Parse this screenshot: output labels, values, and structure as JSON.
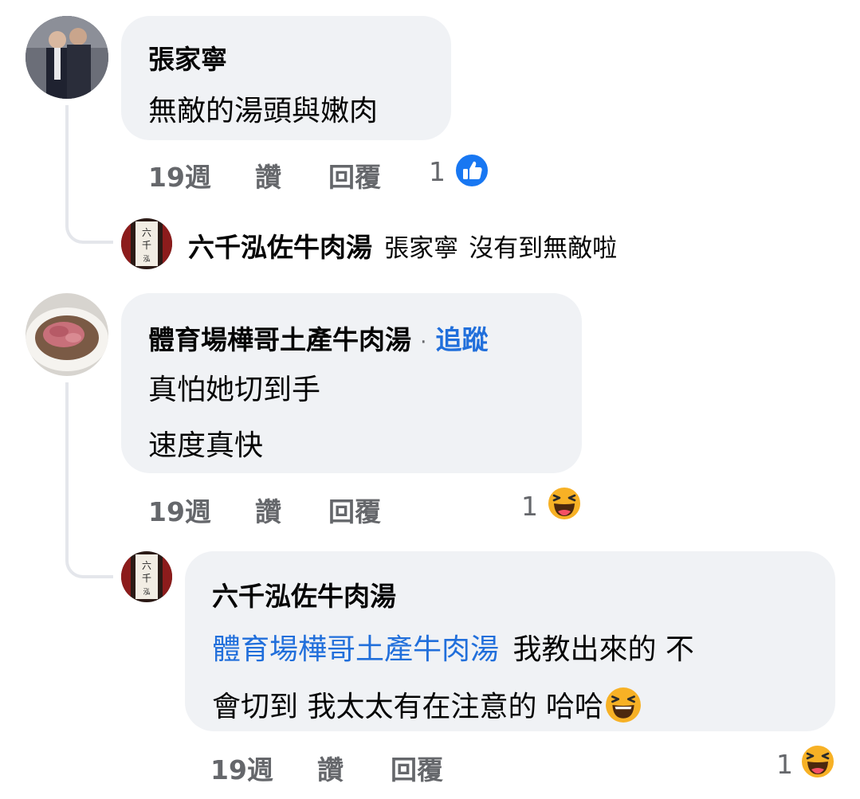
{
  "comments": [
    {
      "author": "張家寧",
      "lines": [
        "無敵的湯頭與嫩肉"
      ],
      "time": "19週",
      "like": "讚",
      "reply": "回覆",
      "reaction_count": "1",
      "reaction_icon": "like-reaction-icon"
    },
    {
      "author": "體育場樺哥土產牛肉湯",
      "follow": "追蹤",
      "follow_separator": "·",
      "lines": [
        "真怕她切到手",
        "速度真快"
      ],
      "time": "19週",
      "like": "讚",
      "reply": "回覆",
      "reaction_count": "1",
      "reaction_icon": "haha-reaction-icon"
    }
  ],
  "replies": [
    {
      "author": "六千泓佐牛肉湯",
      "mention": "張家寧",
      "text": "沒有到無敵啦"
    },
    {
      "author": "六千泓佐牛肉湯",
      "mention": "體育場樺哥土產牛肉湯",
      "text_line1": "我教出來的 不",
      "text_line2": "會切到 我太太有在注意的 哈哈",
      "inline_emoji": "laughing-emoji-icon",
      "time": "19週",
      "like": "讚",
      "reply": "回覆",
      "reaction_count": "1",
      "reaction_icon": "haha-reaction-icon"
    }
  ],
  "colors": {
    "bubble": "#f0f2f5",
    "meta": "#65676b",
    "link": "#216fdb",
    "like_blue": "#1877f2",
    "haha_yellow": "#f7b125"
  }
}
